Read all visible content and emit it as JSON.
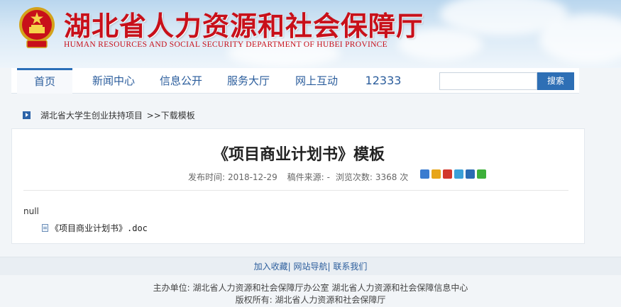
{
  "header": {
    "title": "湖北省人力资源和社会保障厅",
    "subtitle": "HUMAN RESOURCES AND SOCIAL SECURITY DEPARTMENT OF HUBEI PROVINCE"
  },
  "nav": {
    "items": [
      {
        "label": "首页"
      },
      {
        "label": "新闻中心"
      },
      {
        "label": "信息公开"
      },
      {
        "label": "服务大厅"
      },
      {
        "label": "网上互动"
      },
      {
        "label": "12333"
      }
    ],
    "search_placeholder": "",
    "search_button": "搜索"
  },
  "breadcrumb": {
    "items": [
      "湖北省大学生创业扶持项目",
      ">>下载模板"
    ]
  },
  "article": {
    "title": "《项目商业计划书》模板",
    "publish_label": "发布时间:",
    "publish_date": "2018-12-29",
    "source_label": "稿件来源:",
    "source_value": "-",
    "views_label": "浏览次数:",
    "views_value": "3368 次",
    "body": "null",
    "attachment": "《项目商业计划书》.doc"
  },
  "share_icons": [
    {
      "name": "share-plus-icon",
      "color": "#3a7cd0"
    },
    {
      "name": "share-qzone-icon",
      "color": "#e7a518"
    },
    {
      "name": "share-weibo-icon",
      "color": "#d2372c"
    },
    {
      "name": "share-tqq-icon",
      "color": "#3aa0d8"
    },
    {
      "name": "share-renren-icon",
      "color": "#2a6bb3"
    },
    {
      "name": "share-wechat-icon",
      "color": "#3db03a"
    }
  ],
  "footer": {
    "links": [
      "加入收藏",
      "网站导航",
      "联系我们"
    ],
    "host": "主办单位:  湖北省人力资源和社会保障厅办公室  湖北省人力资源和社会保障信息中心",
    "copyright": "版权所有:  湖北省人力资源和社会保障厅"
  },
  "colors": {
    "brand_red": "#c8101a",
    "nav_blue": "#2b5d9c",
    "search_button": "#2e6fb5"
  }
}
